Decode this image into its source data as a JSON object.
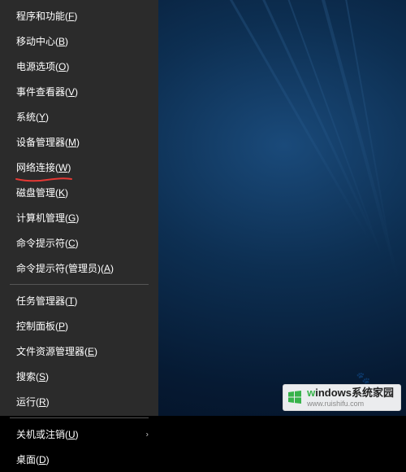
{
  "menu": {
    "groups": [
      [
        {
          "id": "programs-features",
          "label": "程序和功能",
          "mnemonic": "F",
          "submenu": false
        },
        {
          "id": "mobility-center",
          "label": "移动中心",
          "mnemonic": "B",
          "submenu": false
        },
        {
          "id": "power-options",
          "label": "电源选项",
          "mnemonic": "O",
          "submenu": false
        },
        {
          "id": "event-viewer",
          "label": "事件查看器",
          "mnemonic": "V",
          "submenu": false
        },
        {
          "id": "system",
          "label": "系统",
          "mnemonic": "Y",
          "submenu": false
        },
        {
          "id": "device-manager",
          "label": "设备管理器",
          "mnemonic": "M",
          "submenu": false
        },
        {
          "id": "network-connections",
          "label": "网络连接",
          "mnemonic": "W",
          "submenu": false,
          "highlighted": true
        },
        {
          "id": "disk-management",
          "label": "磁盘管理",
          "mnemonic": "K",
          "submenu": false
        },
        {
          "id": "computer-management",
          "label": "计算机管理",
          "mnemonic": "G",
          "submenu": false
        },
        {
          "id": "command-prompt",
          "label": "命令提示符",
          "mnemonic": "C",
          "submenu": false
        },
        {
          "id": "command-prompt-admin",
          "label": "命令提示符(管理员)",
          "mnemonic": "A",
          "submenu": false
        }
      ],
      [
        {
          "id": "task-manager",
          "label": "任务管理器",
          "mnemonic": "T",
          "submenu": false
        },
        {
          "id": "control-panel",
          "label": "控制面板",
          "mnemonic": "P",
          "submenu": false
        },
        {
          "id": "file-explorer",
          "label": "文件资源管理器",
          "mnemonic": "E",
          "submenu": false
        },
        {
          "id": "search",
          "label": "搜索",
          "mnemonic": "S",
          "submenu": false
        },
        {
          "id": "run",
          "label": "运行",
          "mnemonic": "R",
          "submenu": false
        }
      ],
      [
        {
          "id": "shutdown-signout",
          "label": "关机或注销",
          "mnemonic": "U",
          "submenu": true
        },
        {
          "id": "desktop",
          "label": "桌面",
          "mnemonic": "D",
          "submenu": false
        }
      ]
    ]
  },
  "watermark": {
    "title_prefix": "w",
    "title_rest": "indows",
    "title_suffix": "系统家园",
    "url": "www.ruishifu.com"
  }
}
